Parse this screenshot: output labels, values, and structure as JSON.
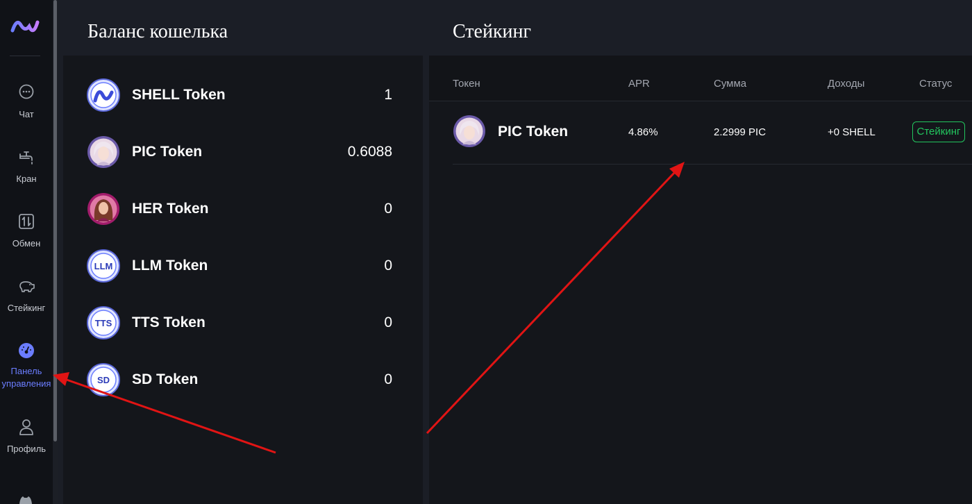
{
  "sidebar": {
    "items": [
      {
        "label": "Чат"
      },
      {
        "label": "Кран"
      },
      {
        "label": "Обмен"
      },
      {
        "label": "Стейкинг"
      },
      {
        "label": "Панель управления"
      },
      {
        "label": "Профиль"
      }
    ],
    "active_color": "#6b7dff"
  },
  "wallet": {
    "title": "Баланс кошелька",
    "tokens": [
      {
        "name": "SHELL Token",
        "balance": "1",
        "icon": "shell-logo-icon"
      },
      {
        "name": "PIC Token",
        "balance": "0.6088",
        "icon": "pic-avatar-icon"
      },
      {
        "name": "HER Token",
        "balance": "0",
        "icon": "her-avatar-icon"
      },
      {
        "name": "LLM Token",
        "balance": "0",
        "icon_text": "LLM"
      },
      {
        "name": "TTS Token",
        "balance": "0",
        "icon_text": "TTS"
      },
      {
        "name": "SD Token",
        "balance": "0",
        "icon_text": "SD"
      }
    ]
  },
  "staking": {
    "title": "Стейкинг",
    "headers": {
      "token": "Токен",
      "apr": "APR",
      "amount": "Сумма",
      "income": "Доходы",
      "status": "Статус"
    },
    "rows": [
      {
        "token": "PIC Token",
        "apr": "4.86%",
        "amount": "2.2999 PIC",
        "income": "+0 SHELL",
        "status": "Стейкинг"
      }
    ],
    "status_color": "#22c55e"
  },
  "annotation_arrow_color": "#e11414"
}
